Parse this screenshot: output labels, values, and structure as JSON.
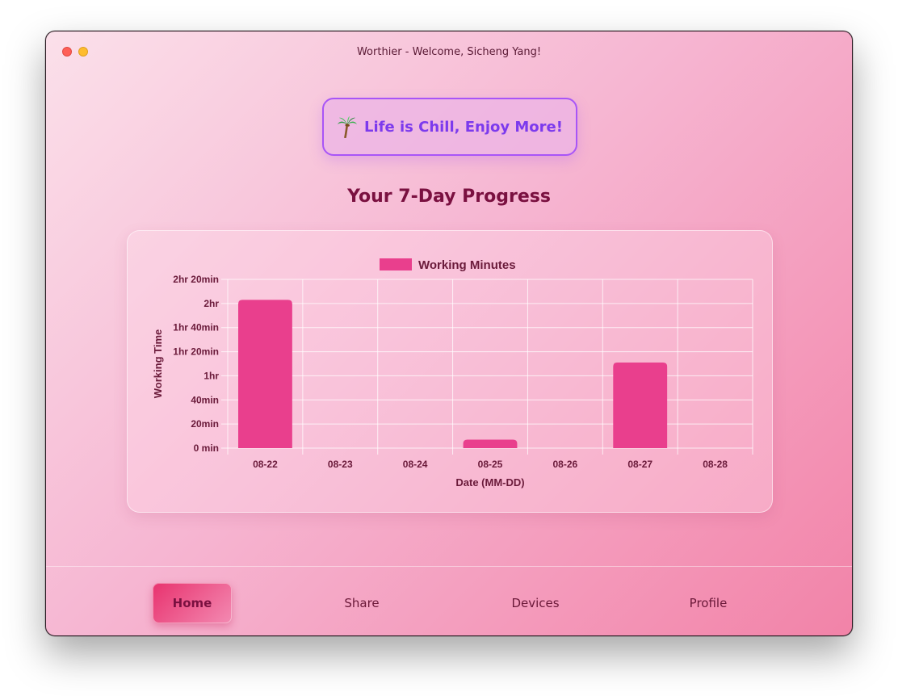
{
  "window": {
    "title": "Worthier - Welcome, Sicheng Yang!"
  },
  "banner": {
    "icon": "palm-tree-icon",
    "text": "Life is Chill, Enjoy More!"
  },
  "section_title": "Your 7-Day Progress",
  "colors": {
    "bar": "#e93f8d",
    "accent": "#a855f7",
    "title": "#7a1040"
  },
  "chart_data": {
    "type": "bar",
    "title": "",
    "legend": [
      "Working Minutes"
    ],
    "legend_placement": "top",
    "categories": [
      "08-22",
      "08-23",
      "08-24",
      "08-25",
      "08-26",
      "08-27",
      "08-28"
    ],
    "series": [
      {
        "name": "Working Minutes",
        "values": [
          123,
          0,
          0,
          7,
          0,
          71,
          0
        ]
      }
    ],
    "xlabel": "Date (MM-DD)",
    "ylabel": "Working Time",
    "ylim": [
      0,
      140
    ],
    "yticks": [
      0,
      20,
      40,
      60,
      80,
      100,
      120,
      140
    ],
    "ytick_labels": [
      "0 min",
      "20min",
      "40min",
      "1hr",
      "1hr 20min",
      "1hr 40min",
      "2hr",
      "2hr 20min"
    ],
    "grid": true
  },
  "nav": {
    "items": [
      {
        "label": "Home",
        "active": true
      },
      {
        "label": "Share",
        "active": false
      },
      {
        "label": "Devices",
        "active": false
      },
      {
        "label": "Profile",
        "active": false
      }
    ]
  }
}
